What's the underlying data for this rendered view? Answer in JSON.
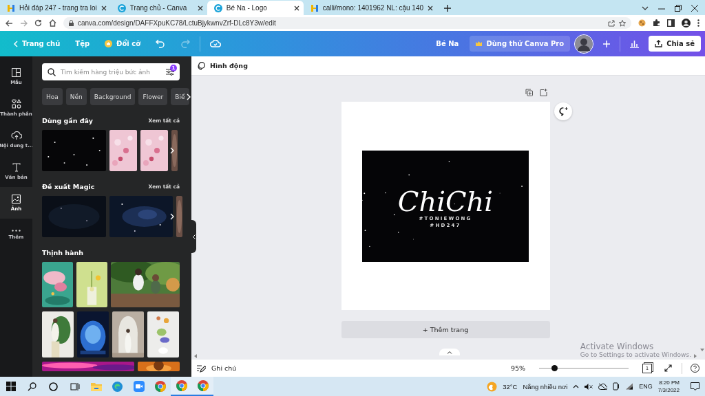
{
  "browser": {
    "tabs": [
      {
        "kind": "hoidap",
        "title": "Hỏi đáp 247 - trang tra loi",
        "selected": false
      },
      {
        "kind": "canva",
        "title": "Trang chủ - Canva",
        "selected": false
      },
      {
        "kind": "canva",
        "title": "Bé Na - Logo",
        "selected": true
      },
      {
        "kind": "hoidap",
        "title": "calli/mono: 1401962 NL: cậu 140",
        "selected": false
      }
    ],
    "address": "canva.com/design/DAFFXpuKC78/LctuBjykwnvZrf-DLc8Y3w/edit"
  },
  "header": {
    "home": "Trang chủ",
    "file": "Tệp",
    "resize": "Đổi cỡ",
    "history": [
      {
        "kind": "undo",
        "disabled": false
      },
      {
        "kind": "redo",
        "disabled": true
      }
    ],
    "title": "Bé Na",
    "pro": "Dùng thử Canva Pro",
    "share": "Chia sẻ"
  },
  "rail": [
    {
      "kind": "templates",
      "label": "Mẫu",
      "selected": false
    },
    {
      "kind": "elements",
      "label": "Thành phần",
      "selected": false
    },
    {
      "kind": "uploads",
      "label": "Nội dung t...",
      "selected": false
    },
    {
      "kind": "text",
      "label": "Văn bản",
      "selected": false
    },
    {
      "kind": "photos",
      "label": "Ảnh",
      "selected": true
    },
    {
      "kind": "more",
      "label": "Thêm",
      "selected": false
    }
  ],
  "panel": {
    "search": {
      "placeholder": "Tìm kiếm hàng triệu bức ảnh",
      "badge": "1"
    },
    "chips": [
      "Hoa",
      "Nền",
      "Background",
      "Flower",
      "Biể"
    ],
    "sections": [
      {
        "title": "Dùng gần đây",
        "link": "Xem tất cả"
      },
      {
        "title": "Đề xuất Magic",
        "link": "Xem tất cả"
      },
      {
        "title": "Thịnh hành"
      }
    ]
  },
  "editor": {
    "toolbar": "Hình động",
    "design": {
      "title": "ChiChi",
      "lines": [
        "#TONIEWONG",
        "#HD247"
      ]
    },
    "add_page": "+ Thêm trang",
    "notice": {
      "title": "Activate Windows",
      "text": "Go to Settings to activate Windows."
    }
  },
  "bottom": {
    "notes": "Ghi chú",
    "zoom": {
      "reading": "95%",
      "level": 0.17
    },
    "pages": "1"
  },
  "taskbar": {
    "apps": [
      {
        "kind": "start",
        "running": false
      },
      {
        "kind": "search",
        "running": false
      },
      {
        "kind": "cortana",
        "running": false
      },
      {
        "kind": "taskview",
        "running": false
      },
      {
        "kind": "explorer",
        "running": false
      },
      {
        "kind": "edge",
        "running": false
      },
      {
        "kind": "zoom",
        "running": false
      },
      {
        "kind": "chrome",
        "running": false
      },
      {
        "kind": "chrome",
        "running": true
      },
      {
        "kind": "chrome",
        "running": true
      }
    ],
    "temperature": "32°C",
    "weather": "Nắng nhiều nơi",
    "language": "ENG",
    "time": "8:20 PM",
    "date": "7/3/2022"
  }
}
